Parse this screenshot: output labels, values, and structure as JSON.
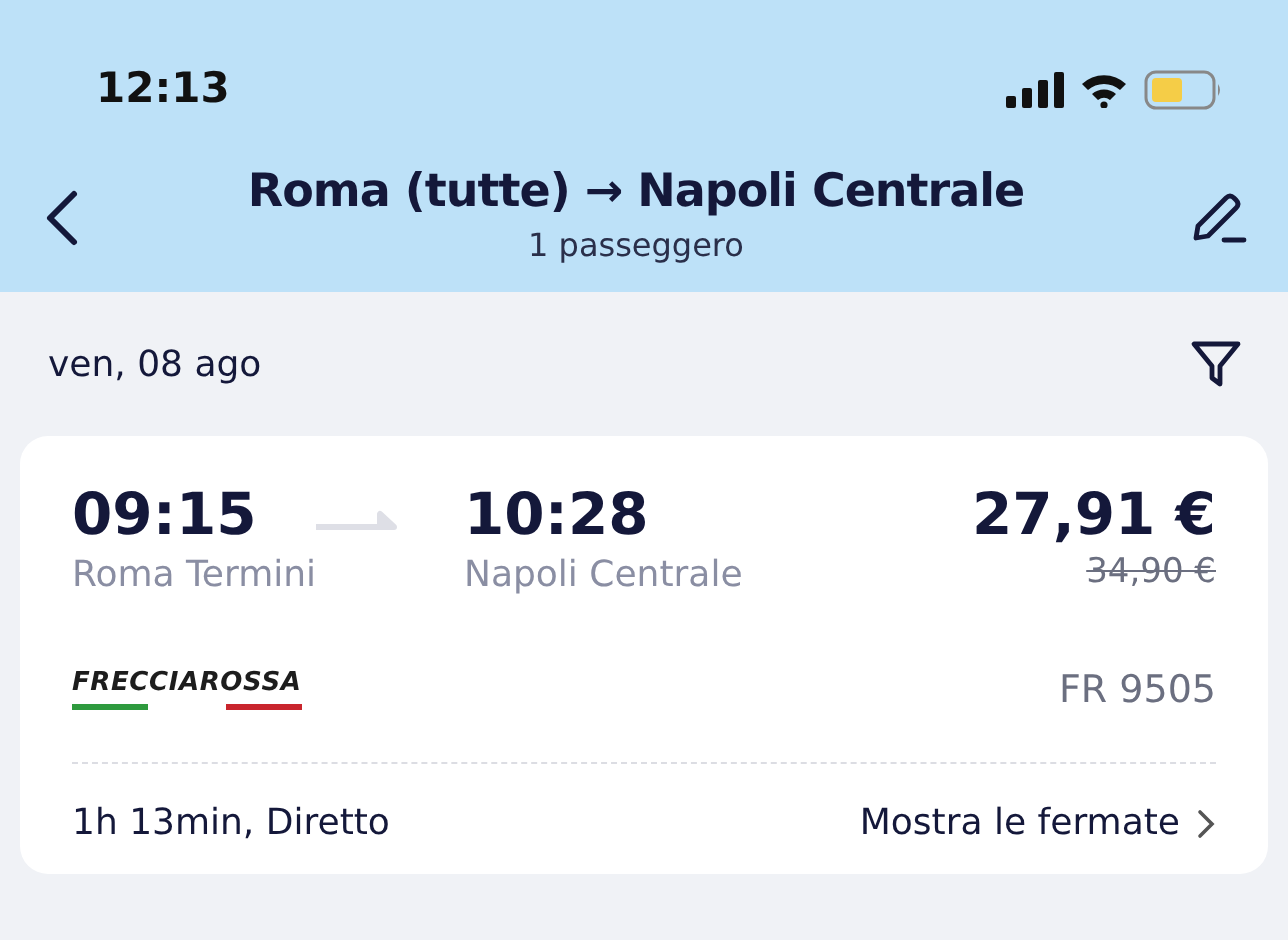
{
  "status_bar": {
    "time": "12:13"
  },
  "header": {
    "title": "Roma (tutte) → Napoli Centrale",
    "subtitle": "1 passeggero"
  },
  "date_bar": {
    "date": "ven, 08 ago"
  },
  "results": [
    {
      "departure_time": "09:15",
      "departure_station": "Roma Termini",
      "arrival_time": "10:28",
      "arrival_station": "Napoli Centrale",
      "price": "27,91 €",
      "old_price": "34,90 €",
      "operator_logo": "FRECCIAROSSA",
      "train_number": "FR 9505",
      "duration": "1h 13min, Diretto",
      "stops_link": "Mostra le fermate"
    }
  ]
}
